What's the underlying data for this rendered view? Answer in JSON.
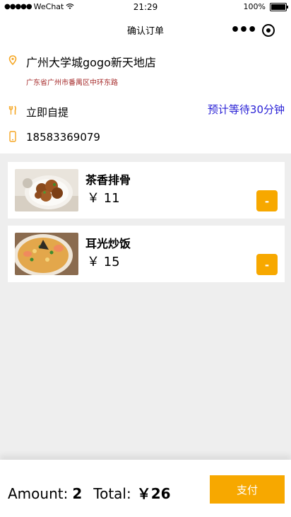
{
  "status_bar": {
    "carrier": "WeChat",
    "time": "21:29",
    "battery": "100%"
  },
  "nav": {
    "title": "确认订单",
    "more_label": "•••"
  },
  "store": {
    "name": "广州大学城gogo新天地店",
    "address": "广东省广州市番禺区中环东路"
  },
  "pickup": {
    "label": "立即自提",
    "wait": "预计等待30分钟"
  },
  "phone": "18583369079",
  "order_items": [
    {
      "name": "茶香排骨",
      "price": "￥ 11",
      "remove_label": "-"
    },
    {
      "name": "耳光炒饭",
      "price": "￥ 15",
      "remove_label": "-"
    }
  ],
  "footer": {
    "amount_label": "Amount:",
    "amount_value": "2",
    "total_label": "Total:",
    "total_value": "￥26",
    "pay_label": "支付"
  },
  "colors": {
    "accent": "#f7a800",
    "wait_text": "#2a22d6",
    "address_text": "#a52a2a"
  }
}
